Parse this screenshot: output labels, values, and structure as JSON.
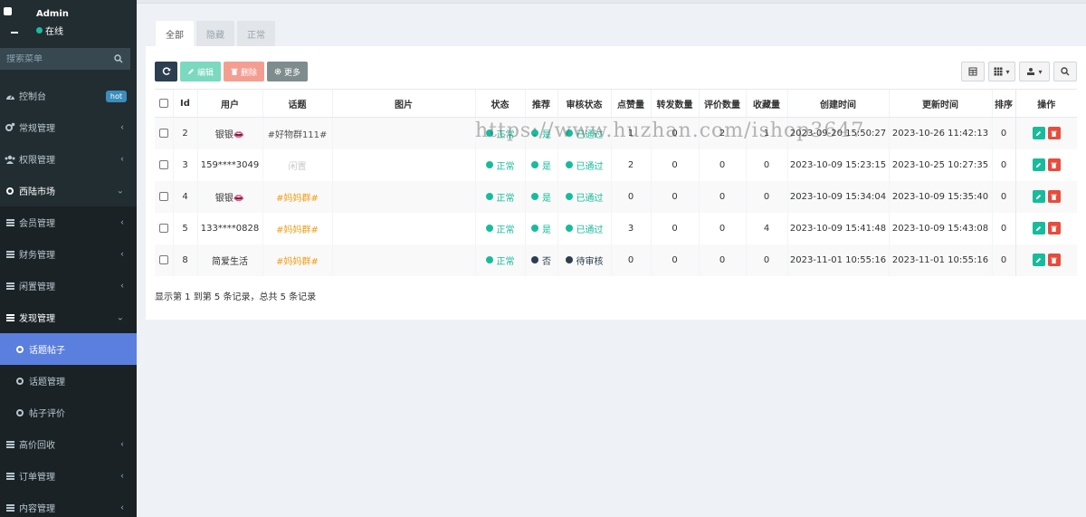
{
  "user": {
    "name": "Admin",
    "status": "在线"
  },
  "search": {
    "placeholder": "搜索菜单"
  },
  "menu": [
    {
      "label": "控制台",
      "badge": "hot"
    },
    {
      "label": "常规管理"
    },
    {
      "label": "权限管理"
    },
    {
      "label": "西陆市场"
    },
    {
      "label": "会员管理"
    },
    {
      "label": "财务管理"
    },
    {
      "label": "闲置管理"
    },
    {
      "label": "发现管理"
    },
    {
      "label": "话题帖子"
    },
    {
      "label": "话题管理"
    },
    {
      "label": "帖子评价"
    },
    {
      "label": "高价回收"
    },
    {
      "label": "订单管理"
    },
    {
      "label": "内容管理"
    }
  ],
  "tabs": [
    "全部",
    "隐藏",
    "正常"
  ],
  "toolbar": {
    "edit": "编辑",
    "delete": "删除",
    "more": "更多"
  },
  "table": {
    "headers": [
      "Id",
      "用户",
      "话题",
      "图片",
      "状态",
      "推荐",
      "审核状态",
      "点赞量",
      "转发数量",
      "评价数量",
      "收藏量",
      "创建时间",
      "更新时间",
      "排序",
      "操作"
    ],
    "rows": [
      {
        "id": "2",
        "user": "银银👄",
        "topic": "#好物群111#",
        "topic_style": "gray",
        "status": "正常",
        "recommend": "是",
        "audit": "已通过",
        "likes": "1",
        "shares": "0",
        "reviews": "2",
        "favorites": "1",
        "created": "2023-09-20 15:50:27",
        "updated": "2023-10-26 11:42:13",
        "sort": "0"
      },
      {
        "id": "3",
        "user": "159****3049",
        "topic": "闲置",
        "topic_style": "light",
        "status": "正常",
        "recommend": "是",
        "audit": "已通过",
        "likes": "2",
        "shares": "0",
        "reviews": "0",
        "favorites": "0",
        "created": "2023-10-09 15:23:15",
        "updated": "2023-10-25 10:27:35",
        "sort": "0"
      },
      {
        "id": "4",
        "user": "银银👄",
        "topic": "#妈妈群#",
        "topic_style": "orange",
        "status": "正常",
        "recommend": "是",
        "audit": "已通过",
        "likes": "0",
        "shares": "0",
        "reviews": "0",
        "favorites": "0",
        "created": "2023-10-09 15:34:04",
        "updated": "2023-10-09 15:35:40",
        "sort": "0"
      },
      {
        "id": "5",
        "user": "133****0828",
        "topic": "#妈妈群#",
        "topic_style": "orange",
        "status": "正常",
        "recommend": "是",
        "audit": "已通过",
        "likes": "3",
        "shares": "0",
        "reviews": "0",
        "favorites": "4",
        "created": "2023-10-09 15:41:48",
        "updated": "2023-10-09 15:43:08",
        "sort": "0"
      },
      {
        "id": "8",
        "user": "简爱生活",
        "topic": "#妈妈群#",
        "topic_style": "orange",
        "status": "正常",
        "recommend": "否",
        "audit": "待审核",
        "likes": "0",
        "shares": "0",
        "reviews": "0",
        "favorites": "0",
        "created": "2023-11-01 10:55:16",
        "updated": "2023-11-01 10:55:16",
        "sort": "0"
      }
    ]
  },
  "summary": "显示第 1 到第 5 条记录，总共 5 条记录",
  "watermark": "https://www.huzhan.com/ishop3647",
  "colors": {
    "sidebar": "#222d32",
    "active": "#5b7fde",
    "success": "#18bc9c",
    "danger": "#e74c3c",
    "navy": "#2c3e50",
    "orange": "#f39c12"
  }
}
